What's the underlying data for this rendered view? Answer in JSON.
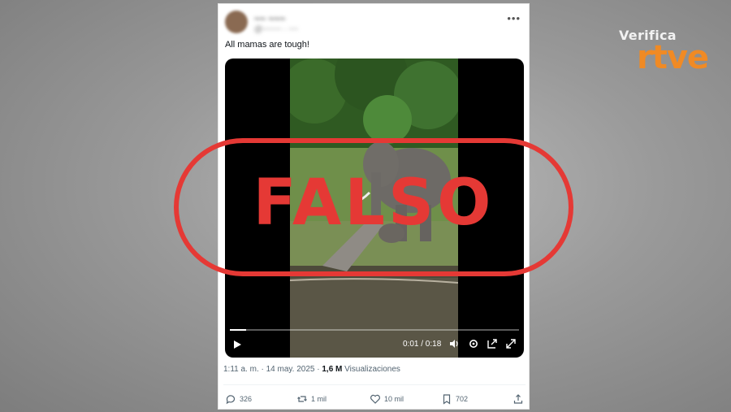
{
  "brand": {
    "small": "Verifica",
    "big": "rtve"
  },
  "tweet": {
    "author_name": "~~ ~~~",
    "author_handle": "@~~~~ · ~~",
    "text": "All mamas are tough!",
    "more_icon": "more-icon"
  },
  "video": {
    "watermark": "",
    "time": "0:01 / 0:18",
    "progress": 0.055
  },
  "stamp": {
    "label": "FALSO",
    "color": "#e53935"
  },
  "meta": {
    "time": "1:11 a. m.",
    "date": "14 may. 2025",
    "views": "1,6 M",
    "views_label": "Visualizaciones"
  },
  "actions": {
    "replies": "326",
    "reposts": "1 mil",
    "likes": "10 mil",
    "bookmarks": "702"
  },
  "colors": {
    "brand_orange": "#f08a24",
    "stamp_red": "#e53935"
  }
}
